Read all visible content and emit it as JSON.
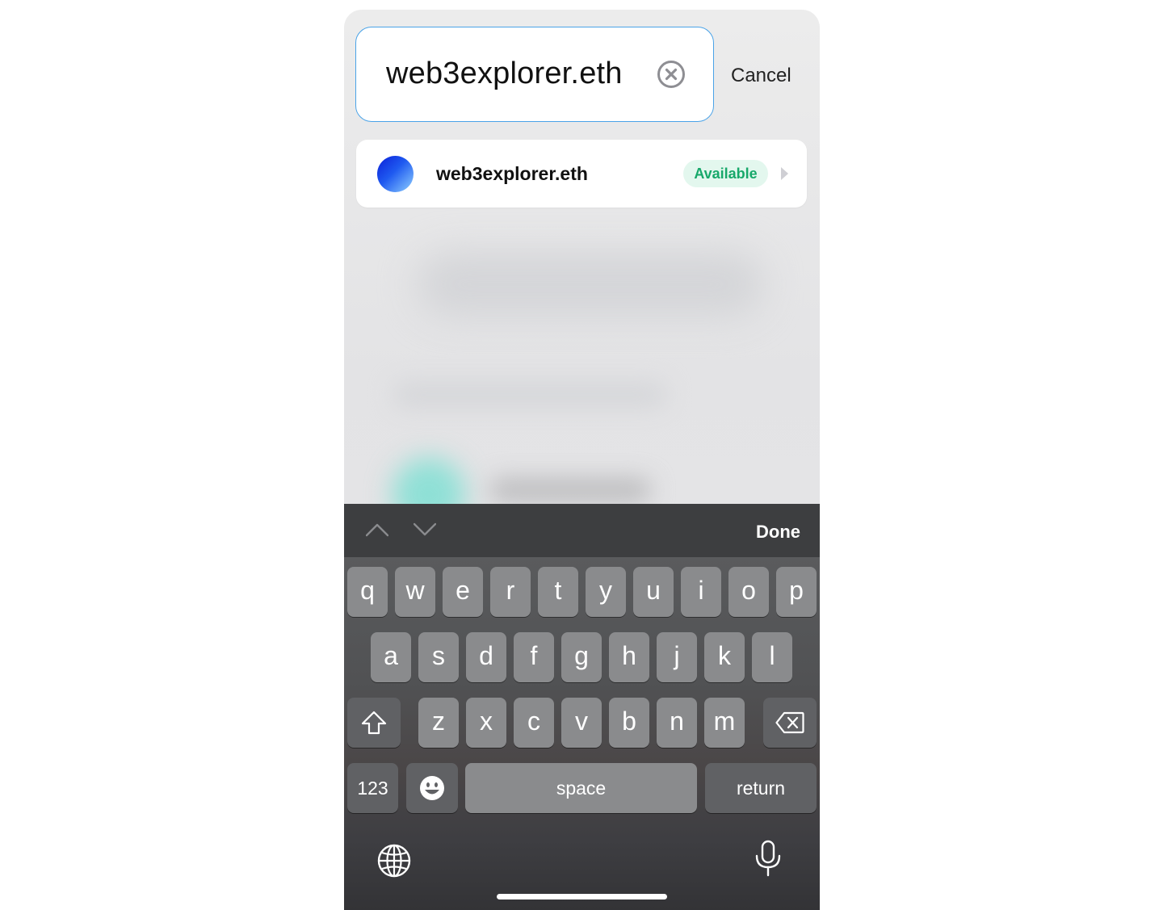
{
  "search": {
    "value": "web3explorer.eth",
    "cancel_label": "Cancel"
  },
  "result": {
    "name": "web3explorer.eth",
    "status": "Available",
    "status_color": "#17a86a"
  },
  "toolbar": {
    "done_label": "Done"
  },
  "keyboard": {
    "row1": [
      "q",
      "w",
      "e",
      "r",
      "t",
      "y",
      "u",
      "i",
      "o",
      "p"
    ],
    "row2": [
      "a",
      "s",
      "d",
      "f",
      "g",
      "h",
      "j",
      "k",
      "l"
    ],
    "row3": [
      "z",
      "x",
      "c",
      "v",
      "b",
      "n",
      "m"
    ],
    "numbers_label": "123",
    "space_label": "space",
    "return_label": "return"
  },
  "colors": {
    "accent_border": "#4aa3e8",
    "key_bg": "#8a8b8d"
  }
}
